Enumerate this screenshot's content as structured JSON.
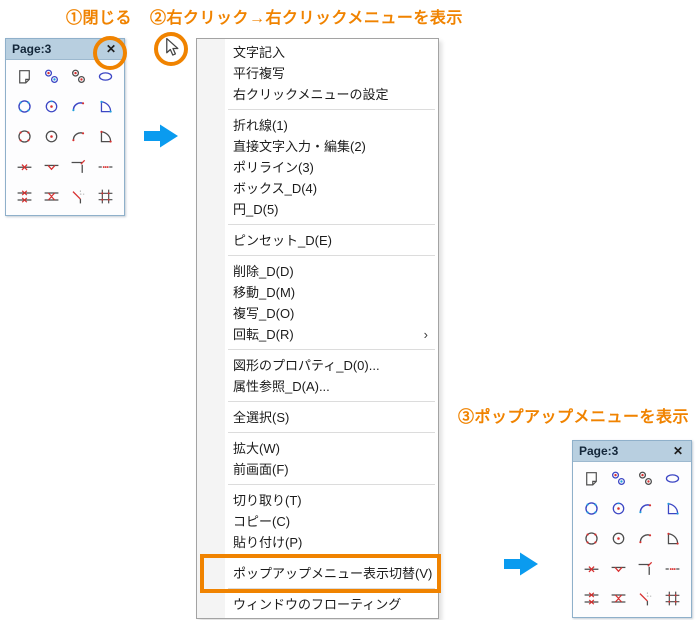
{
  "annotations": {
    "step1": "①閉じる",
    "step2": "②右クリック→右クリックメニューを表示",
    "step3": "③ポップアップメニューを表示"
  },
  "palette": {
    "title": "Page:3",
    "close_glyph": "✕",
    "icons": [
      "new-page-icon",
      "double-circle-blue-icon",
      "double-circle-dark-icon",
      "ellipse-icon",
      "circle-nodes-blue-icon",
      "circle-center-blue-icon",
      "arc-blue-icon",
      "fan-blue-icon",
      "circle-nodes-dark-icon",
      "circle-center-dark-icon",
      "arc-dark-icon",
      "fan-dark-icon",
      "line-break-icon",
      "line-vertex-icon",
      "corner-line-icon",
      "dotted-line-icon",
      "double-line-break-icon",
      "double-line-vertex-icon",
      "chamfer-line-icon",
      "lattice-line-icon"
    ]
  },
  "menu": {
    "items": [
      {
        "type": "item",
        "label": "文字記入"
      },
      {
        "type": "item",
        "label": "平行複写"
      },
      {
        "type": "item",
        "label": "右クリックメニューの設定"
      },
      {
        "type": "separator"
      },
      {
        "type": "item",
        "label": "折れ線(1)"
      },
      {
        "type": "item",
        "label": "直接文字入力・編集(2)"
      },
      {
        "type": "item",
        "label": "ポリライン(3)"
      },
      {
        "type": "item",
        "label": "ボックス_D(4)"
      },
      {
        "type": "item",
        "label": "円_D(5)"
      },
      {
        "type": "separator"
      },
      {
        "type": "item",
        "label": "ピンセット_D(E)"
      },
      {
        "type": "separator"
      },
      {
        "type": "item",
        "label": "削除_D(D)"
      },
      {
        "type": "item",
        "label": "移動_D(M)"
      },
      {
        "type": "item",
        "label": "複写_D(O)"
      },
      {
        "type": "item",
        "label": "回転_D(R)",
        "submenu": true
      },
      {
        "type": "separator"
      },
      {
        "type": "item",
        "label": "図形のプロパティ_D(0)..."
      },
      {
        "type": "item",
        "label": "属性参照_D(A)..."
      },
      {
        "type": "separator"
      },
      {
        "type": "item",
        "label": "全選択(S)"
      },
      {
        "type": "separator"
      },
      {
        "type": "item",
        "label": "拡大(W)"
      },
      {
        "type": "item",
        "label": "前画面(F)"
      },
      {
        "type": "separator"
      },
      {
        "type": "item",
        "label": "切り取り(T)"
      },
      {
        "type": "item",
        "label": "コピー(C)"
      },
      {
        "type": "item",
        "label": "貼り付け(P)"
      },
      {
        "type": "separator"
      },
      {
        "type": "item",
        "label": "ポップアップメニュー表示切替(V)",
        "highlighted": true
      },
      {
        "type": "separator"
      },
      {
        "type": "item",
        "label": "ウィンドウのフローティング"
      }
    ],
    "submenu_glyph": "›"
  },
  "colors": {
    "accent_orange": "#F08300",
    "arrow_blue": "#0A9BEF",
    "titlebar_blue": "#B8CFE0",
    "icon_blue": "#3C46C4",
    "icon_dark": "#4D4D4D",
    "icon_red": "#D83030",
    "icon_cyan": "#1FA0DC"
  }
}
